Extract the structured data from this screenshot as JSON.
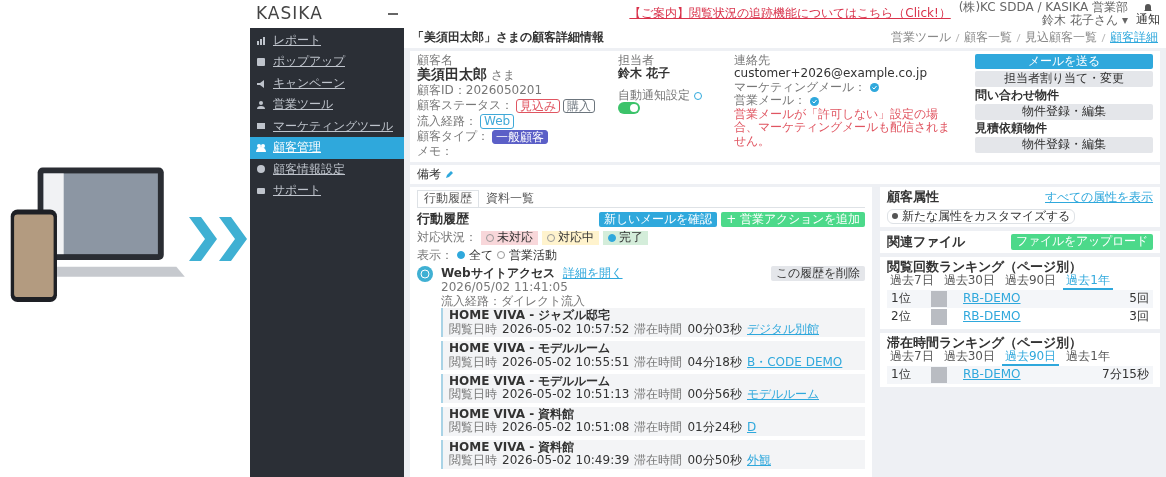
{
  "app": {
    "logo": "KASIKA",
    "notice_link": "【ご案内】閲覧状況の追跡機能についてはこちら（Click!）",
    "account": {
      "company": "(株)KC SDDA / KASIKA 営業部",
      "user": "鈴木 花子さん ▾"
    },
    "notifications_label": "通知",
    "sidebar": [
      {
        "label": "レポート",
        "selected": false
      },
      {
        "label": "ポップアップ",
        "selected": false
      },
      {
        "label": "キャンペーン",
        "selected": false
      },
      {
        "label": "営業ツール",
        "selected": false
      },
      {
        "label": "マーケティングツール",
        "selected": false
      },
      {
        "label": "顧客管理",
        "selected": true
      },
      {
        "label": "顧客情報設定",
        "selected": false
      },
      {
        "label": "サポート",
        "selected": false
      }
    ],
    "page_title": "「美須田太郎」さまの顧客詳細情報",
    "breadcrumb": [
      "営業ツール",
      "顧客一覧",
      "見込顧客一覧",
      "顧客詳細"
    ],
    "customer": {
      "name_label": "顧客名",
      "name": "美須田太郎",
      "honorific": "さま",
      "fields": [
        {
          "label": "顧客ID：2026050201"
        },
        {
          "label": "顧客ステータス：",
          "tags": [
            {
              "text": "見込み",
              "color": "#e05561",
              "kind": "outline"
            },
            {
              "text": "購入",
              "color": "#6c757d",
              "kind": "outline"
            }
          ]
        },
        {
          "label": "流入経路：",
          "tags": [
            {
              "text": "Web",
              "color": "#3fa9d8",
              "kind": "outline"
            }
          ]
        },
        {
          "label": "顧客タイプ：",
          "tags": [
            {
              "text": "一般顧客",
              "color": "#5b5fc7",
              "kind": "filled"
            }
          ]
        },
        {
          "label": "メモ："
        }
      ],
      "owner_label": "担当者",
      "owner": "鈴木 花子",
      "auto_notify": {
        "label": "自動通知設定",
        "on": true
      },
      "contact_label": "連絡先",
      "email": "customer+2026@example.co.jp",
      "mail_settings": [
        {
          "label": "マーケティングメール：",
          "checked": true
        },
        {
          "label": "営業メール：",
          "checked": true
        }
      ],
      "mail_warning": "営業メールが「許可しない」設定の場合、マーケティングメールも配信されません。",
      "actions": [
        {
          "kind": "primary",
          "label": "メールを送る"
        },
        {
          "kind": "secondary",
          "label": "担当者割り当て・変更"
        },
        {
          "kind": "caption",
          "label": "問い合わせ物件"
        },
        {
          "kind": "secondary",
          "label": "物件登録・編集"
        },
        {
          "kind": "caption",
          "label": "見積依頼物件"
        },
        {
          "kind": "secondary",
          "label": "物件登録・編集"
        }
      ]
    },
    "note_label": "備考",
    "activity": {
      "tabs": [
        {
          "label": "行動履歴",
          "selected": true
        },
        {
          "label": "資料一覧",
          "selected": false
        }
      ],
      "title": "行動履歴",
      "buttons": [
        {
          "kind": "primary",
          "label": "新しいメールを確認"
        },
        {
          "kind": "success",
          "label": "+ 営業アクションを追加"
        }
      ],
      "status_label": "対応状況：",
      "statuses": [
        {
          "label": "未対応",
          "color": "#f8d7da",
          "selected": false
        },
        {
          "label": "対応中",
          "color": "#fff3cd",
          "selected": false
        },
        {
          "label": "完了",
          "color": "#d4edda",
          "selected": true
        }
      ],
      "display_label": "表示：",
      "display_options": [
        {
          "label": "全て",
          "selected": true
        },
        {
          "label": "営業活動",
          "selected": false
        }
      ],
      "entry": {
        "title": "Webサイトアクセス",
        "link": "詳細を開く",
        "time": "2026/05/02 11:41:05",
        "source": "流入経路：ダイレクト流入",
        "delete": "この履歴を削除",
        "visits": [
          {
            "title": "HOME VIVA - ジャズル邸宅",
            "time_label": "閲覧日時",
            "time": "2026-05-02 10:57:52",
            "duration_label": "滞在時間",
            "duration": "00分03秒",
            "page": "デジタル別館"
          },
          {
            "title": "HOME VIVA - モデルルーム",
            "time_label": "閲覧日時",
            "time": "2026-05-02 10:55:51",
            "duration_label": "滞在時間",
            "duration": "04分18秒",
            "page": "B・CODE DEMO"
          },
          {
            "title": "HOME VIVA - モデルルーム",
            "time_label": "閲覧日時",
            "time": "2026-05-02 10:51:13",
            "duration_label": "滞在時間",
            "duration": "00分56秒",
            "page": "モデルルーム"
          },
          {
            "title": "HOME VIVA - 資料館",
            "time_label": "閲覧日時",
            "time": "2026-05-02 10:51:08",
            "duration_label": "滞在時間",
            "duration": "01分24秒",
            "page": "D"
          },
          {
            "title": "HOME VIVA - 資料館",
            "time_label": "閲覧日時",
            "time": "2026-05-02 10:49:39",
            "duration_label": "滞在時間",
            "duration": "00分50秒",
            "page": "外観"
          }
        ]
      }
    },
    "attributes": {
      "title": "顧客属性",
      "link": "すべての属性を表示",
      "chip": "新たな属性をカスタマイズする"
    },
    "files": {
      "title": "関連ファイル",
      "button": "ファイルをアップロード"
    },
    "rankings": [
      {
        "title": "閲覧回数ランキング（ページ別）",
        "tabs": [
          {
            "label": "過去7日",
            "selected": false
          },
          {
            "label": "過去30日",
            "selected": false
          },
          {
            "label": "過去90日",
            "selected": false
          },
          {
            "label": "過去1年",
            "selected": true
          }
        ],
        "rows": [
          {
            "rank": "1位",
            "name": "RB-DEMO",
            "value": "5回"
          },
          {
            "rank": "2位",
            "name": "RB-DEMO",
            "value": "3回"
          }
        ]
      },
      {
        "title": "滞在時間ランキング（ページ別）",
        "tabs": [
          {
            "label": "過去7日",
            "selected": false
          },
          {
            "label": "過去30日",
            "selected": false
          },
          {
            "label": "過去90日",
            "selected": true
          },
          {
            "label": "過去1年",
            "selected": false
          }
        ],
        "rows": [
          {
            "rank": "1位",
            "name": "RB-DEMO",
            "value": "7分15秒"
          }
        ]
      }
    ]
  }
}
